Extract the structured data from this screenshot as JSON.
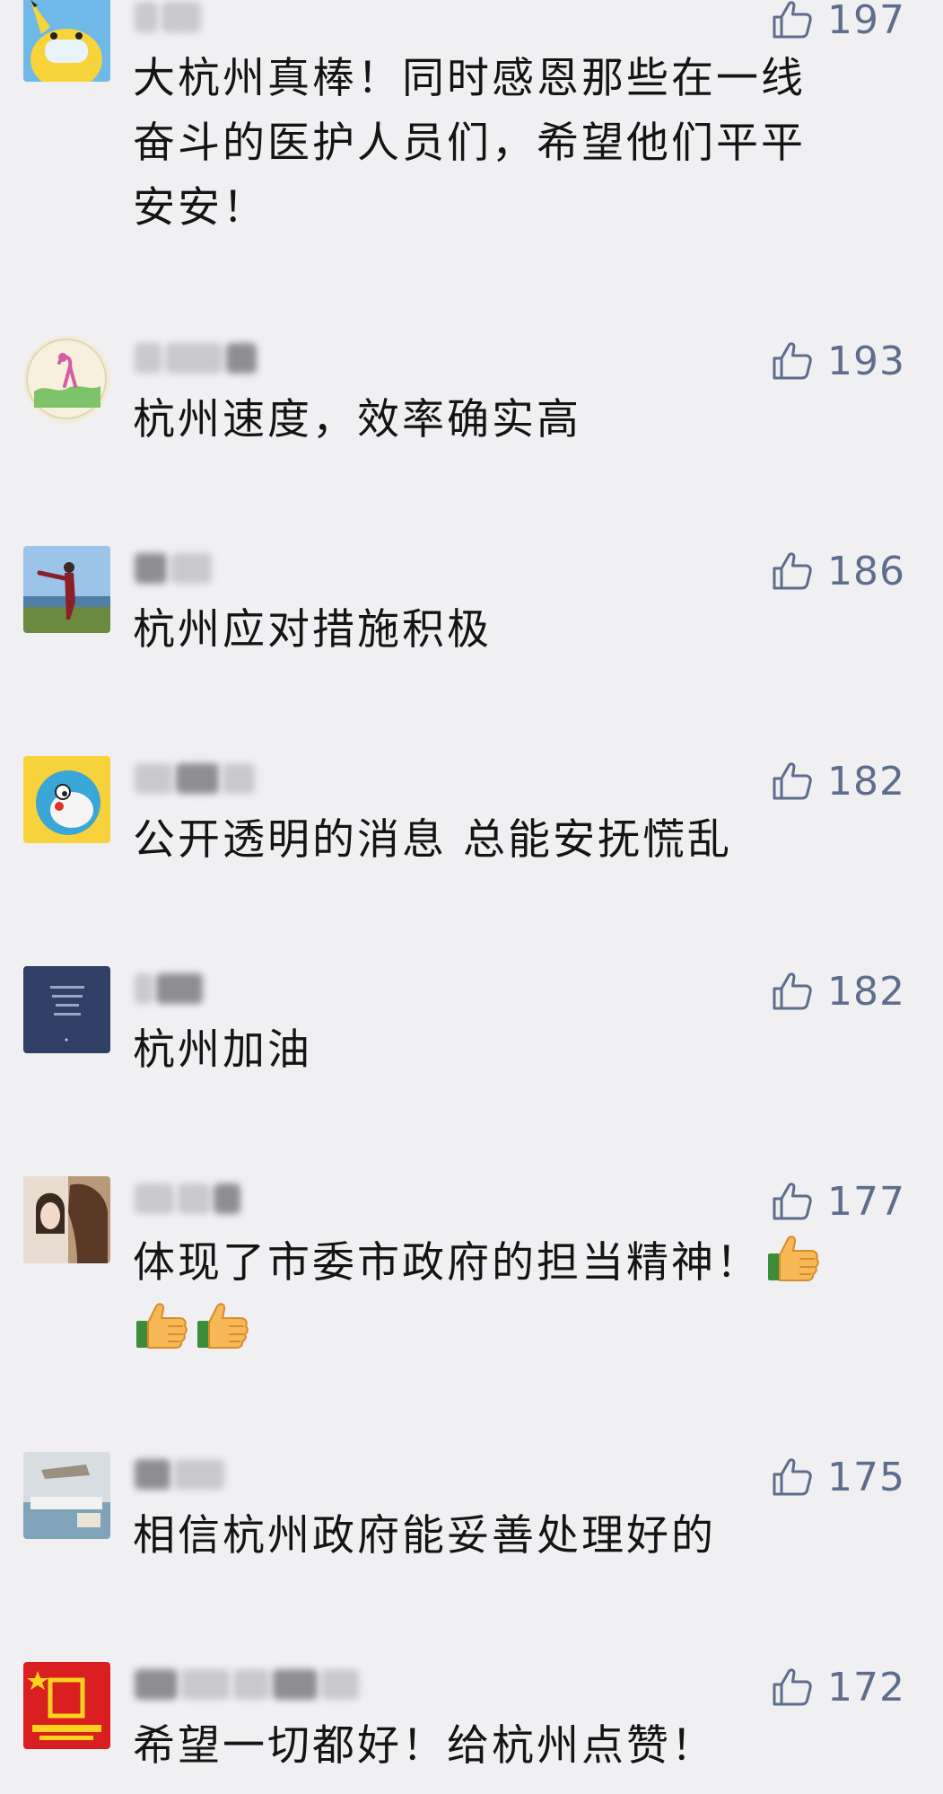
{
  "comments": [
    {
      "likes": "197",
      "text_lines": [
        "大杭州真棒！同时感恩那些在一线",
        "奋斗的医护人员们，希望他们平平",
        "安安！"
      ]
    },
    {
      "likes": "193",
      "text": "杭州速度，效率确实高"
    },
    {
      "likes": "186",
      "text": "杭州应对措施积极"
    },
    {
      "likes": "182",
      "text": "公开透明的消息 总能安抚慌乱"
    },
    {
      "likes": "182",
      "text": "杭州加油"
    },
    {
      "likes": "177",
      "text_line1": "体现了市委市政府的担当精神！"
    },
    {
      "likes": "175",
      "text": "相信杭州政府能妥善处理好的"
    },
    {
      "likes": "172",
      "text": "希望一切都好！给杭州点赞！"
    }
  ],
  "icons": {
    "like": "thumb-up-outline-icon",
    "emoji": "thumbs-up-emoji-icon"
  },
  "colors": {
    "background": "#f0f0f2",
    "like_count": "#5e6d8e",
    "text": "#141414"
  }
}
